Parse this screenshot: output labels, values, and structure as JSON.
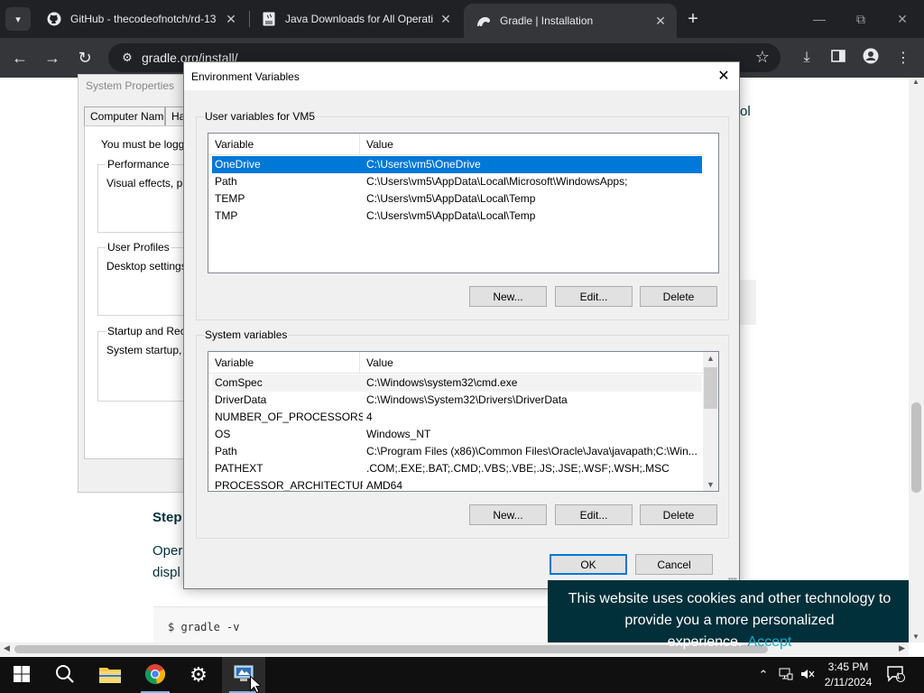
{
  "browser": {
    "tabs": [
      {
        "title": "GitHub - thecodeofnotch/rd-13",
        "icon": "github-icon",
        "active": false
      },
      {
        "title": "Java Downloads for All Operati",
        "icon": "java-page-icon",
        "active": false
      },
      {
        "title": "Gradle | Installation",
        "icon": "gradle-icon",
        "active": true
      }
    ],
    "url": "gradle.org/install/"
  },
  "page": {
    "partial_right": "ol",
    "step_fragment": "Step",
    "open_fragment": "Oper",
    "display_fragment": "displ",
    "code": "$ gradle -v",
    "cookie": {
      "text": "This website uses cookies and other technology to provide you a more personalized experience.",
      "accept": "Accept"
    }
  },
  "system_properties": {
    "title": "System Properties",
    "tabs": [
      "Computer Name",
      "Ha"
    ],
    "logged_text": "You must be logged",
    "performance": {
      "title": "Performance",
      "text": "Visual effects, proc"
    },
    "user_profiles": {
      "title": "User Profiles",
      "text": "Desktop settings re"
    },
    "startup": {
      "title": "Startup and Recov",
      "text": "System startup, sys"
    }
  },
  "env_dialog": {
    "title": "Environment Variables",
    "user_group_title": "User variables for VM5",
    "system_group_title": "System variables",
    "columns": [
      "Variable",
      "Value"
    ],
    "user_vars": [
      {
        "name": "OneDrive",
        "value": "C:\\Users\\vm5\\OneDrive"
      },
      {
        "name": "Path",
        "value": "C:\\Users\\vm5\\AppData\\Local\\Microsoft\\WindowsApps;"
      },
      {
        "name": "TEMP",
        "value": "C:\\Users\\vm5\\AppData\\Local\\Temp"
      },
      {
        "name": "TMP",
        "value": "C:\\Users\\vm5\\AppData\\Local\\Temp"
      }
    ],
    "system_vars": [
      {
        "name": "ComSpec",
        "value": "C:\\Windows\\system32\\cmd.exe"
      },
      {
        "name": "DriverData",
        "value": "C:\\Windows\\System32\\Drivers\\DriverData"
      },
      {
        "name": "NUMBER_OF_PROCESSORS",
        "value": "4"
      },
      {
        "name": "OS",
        "value": "Windows_NT"
      },
      {
        "name": "Path",
        "value": "C:\\Program Files (x86)\\Common Files\\Oracle\\Java\\javapath;C:\\Win..."
      },
      {
        "name": "PATHEXT",
        "value": ".COM;.EXE;.BAT;.CMD;.VBS;.VBE;.JS;.JSE;.WSF;.WSH;.MSC"
      },
      {
        "name": "PROCESSOR_ARCHITECTURE",
        "value": "AMD64"
      }
    ],
    "buttons": {
      "new": "New...",
      "edit": "Edit...",
      "delete": "Delete",
      "ok": "OK",
      "cancel": "Cancel"
    },
    "selected_color": "#0078d7"
  },
  "taskbar": {
    "time": "3:45 PM",
    "date": "2/11/2024",
    "notification_count": "1"
  }
}
